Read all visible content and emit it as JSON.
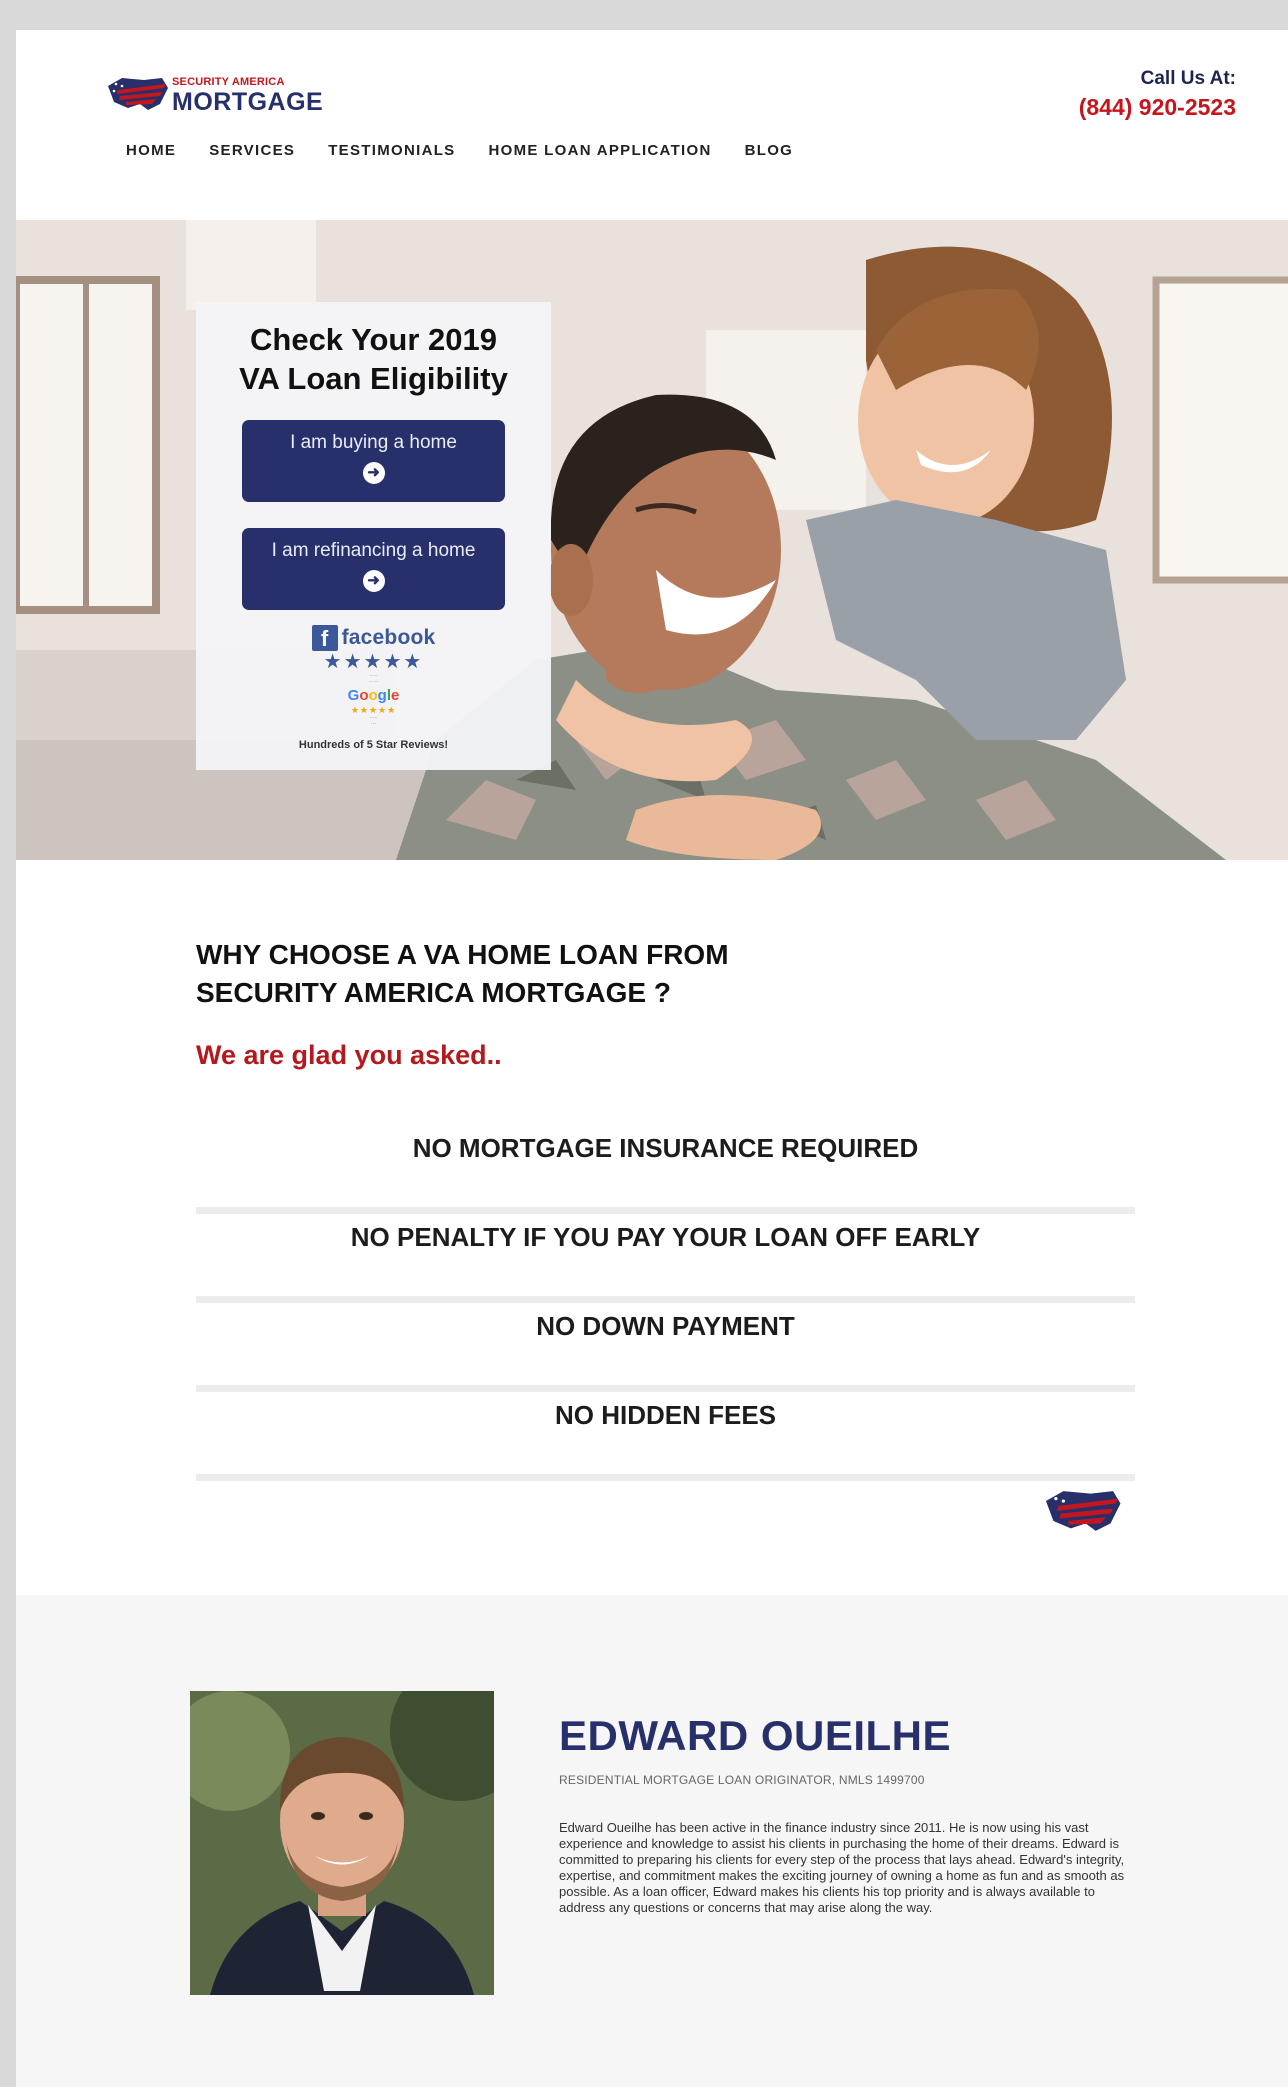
{
  "header": {
    "logo_small": "SECURITY AMERICA",
    "logo_big": "MORTGAGE",
    "call_label": "Call Us At:",
    "phone": "(844) 920-2523"
  },
  "nav": {
    "items": [
      "HOME",
      "SERVICES",
      "TESTIMONIALS",
      "HOME LOAN APPLICATION",
      "BLOG"
    ]
  },
  "hero": {
    "card_title_line1": "Check Your 2019",
    "card_title_line2": "VA Loan Eligibility",
    "cta_buy": "I am buying a home",
    "cta_refi": "I am refinancing a home",
    "facebook_label": "facebook",
    "reviews_text": "Hundreds of 5 Star Reviews!"
  },
  "why": {
    "title_line1": "WHY CHOOSE A VA HOME LOAN FROM",
    "title_line2": "SECURITY AMERICA MORTGAGE ?",
    "subtitle": "We are glad you asked..",
    "benefits": [
      "NO MORTGAGE INSURANCE REQUIRED",
      "NO PENALTY IF YOU PAY YOUR LOAN OFF EARLY",
      "NO DOWN PAYMENT",
      "NO HIDDEN FEES"
    ]
  },
  "bio": {
    "name": "EDWARD OUEILHE",
    "role": "RESIDENTIAL MORTGAGE LOAN ORIGINATOR, NMLS 1499700",
    "text": "Edward Oueilhe has been active in the finance industry since 2011. He is now using his vast experience and knowledge to assist his clients in purchasing the home of their dreams. Edward is committed to preparing his clients for every step of the process that lays ahead. Edward's integrity, expertise, and commitment makes the exciting journey of owning a home as fun and as smooth as possible. As a loan officer, Edward makes his clients his top priority and is always available to address any questions or concerns that may arise along the way."
  },
  "colors": {
    "brand_navy": "#27306b",
    "brand_red": "#c4161c",
    "facebook_blue": "#3b5998"
  }
}
